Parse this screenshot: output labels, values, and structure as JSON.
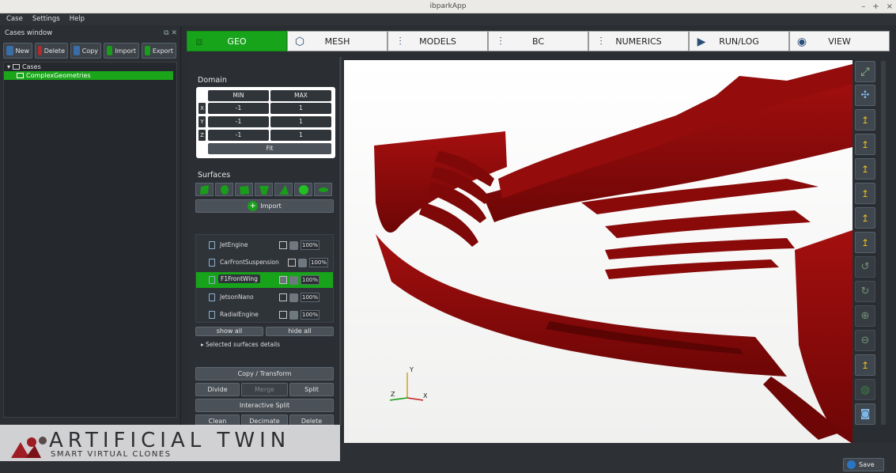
{
  "window": {
    "title": "ibparkApp",
    "controls": [
      "–",
      "+",
      "×"
    ]
  },
  "menu": [
    "Case",
    "Settings",
    "Help"
  ],
  "cases_window": {
    "title": "Cases window",
    "toolbar": [
      "New",
      "Delete",
      "Copy",
      "Import",
      "Export"
    ],
    "tree": {
      "root": "Cases",
      "selected": "ComplexGeometries"
    }
  },
  "tabs": [
    {
      "label": "GEO",
      "icon": "geo-icon",
      "active": true
    },
    {
      "label": "MESH",
      "icon": "mesh-icon"
    },
    {
      "label": "MODELS",
      "icon": "sliders-icon"
    },
    {
      "label": "BC",
      "icon": "sliders-icon"
    },
    {
      "label": "NUMERICS",
      "icon": "sliders-icon"
    },
    {
      "label": "RUN/LOG",
      "icon": "play-icon"
    },
    {
      "label": "VIEW",
      "icon": "eye-icon"
    }
  ],
  "domain": {
    "title": "Domain",
    "header": {
      "min": "MIN",
      "max": "MAX"
    },
    "rows": [
      {
        "axis": "X",
        "min": "-1",
        "max": "1"
      },
      {
        "axis": "Y",
        "min": "-1",
        "max": "1"
      },
      {
        "axis": "Z",
        "min": "-1",
        "max": "1"
      }
    ],
    "fit_label": "Fit"
  },
  "surfaces": {
    "title": "Surfaces",
    "import_label": "Import",
    "items": [
      {
        "name": "JetEngine",
        "percent": "100%"
      },
      {
        "name": "CarFrontSuspension",
        "percent": "100%"
      },
      {
        "name": "F1FrontWing",
        "percent": "100%",
        "selected": true
      },
      {
        "name": "JetsonNano",
        "percent": "100%"
      },
      {
        "name": "RadialEngine",
        "percent": "100%"
      }
    ],
    "show_all": "show all",
    "hide_all": "hide all",
    "details": "Selected surfaces details"
  },
  "operations": {
    "copy_transform": "Copy / Transform",
    "divide": "Divide",
    "merge": "Merge",
    "split": "Split",
    "interactive_split": "Interactive Split",
    "clean": "Clean",
    "decimate": "Decimate",
    "delete": "Delete"
  },
  "axes": {
    "y": "Y",
    "z": "Z",
    "x": "X"
  },
  "logo": {
    "line1": "ARTIFICIAL TWIN",
    "line2": "SMART VIRTUAL CLONES"
  },
  "save_label": "Save",
  "colors": {
    "accent_green": "#17a31a",
    "model_red": "#8c0a0a",
    "panel": "#2b2f34"
  }
}
